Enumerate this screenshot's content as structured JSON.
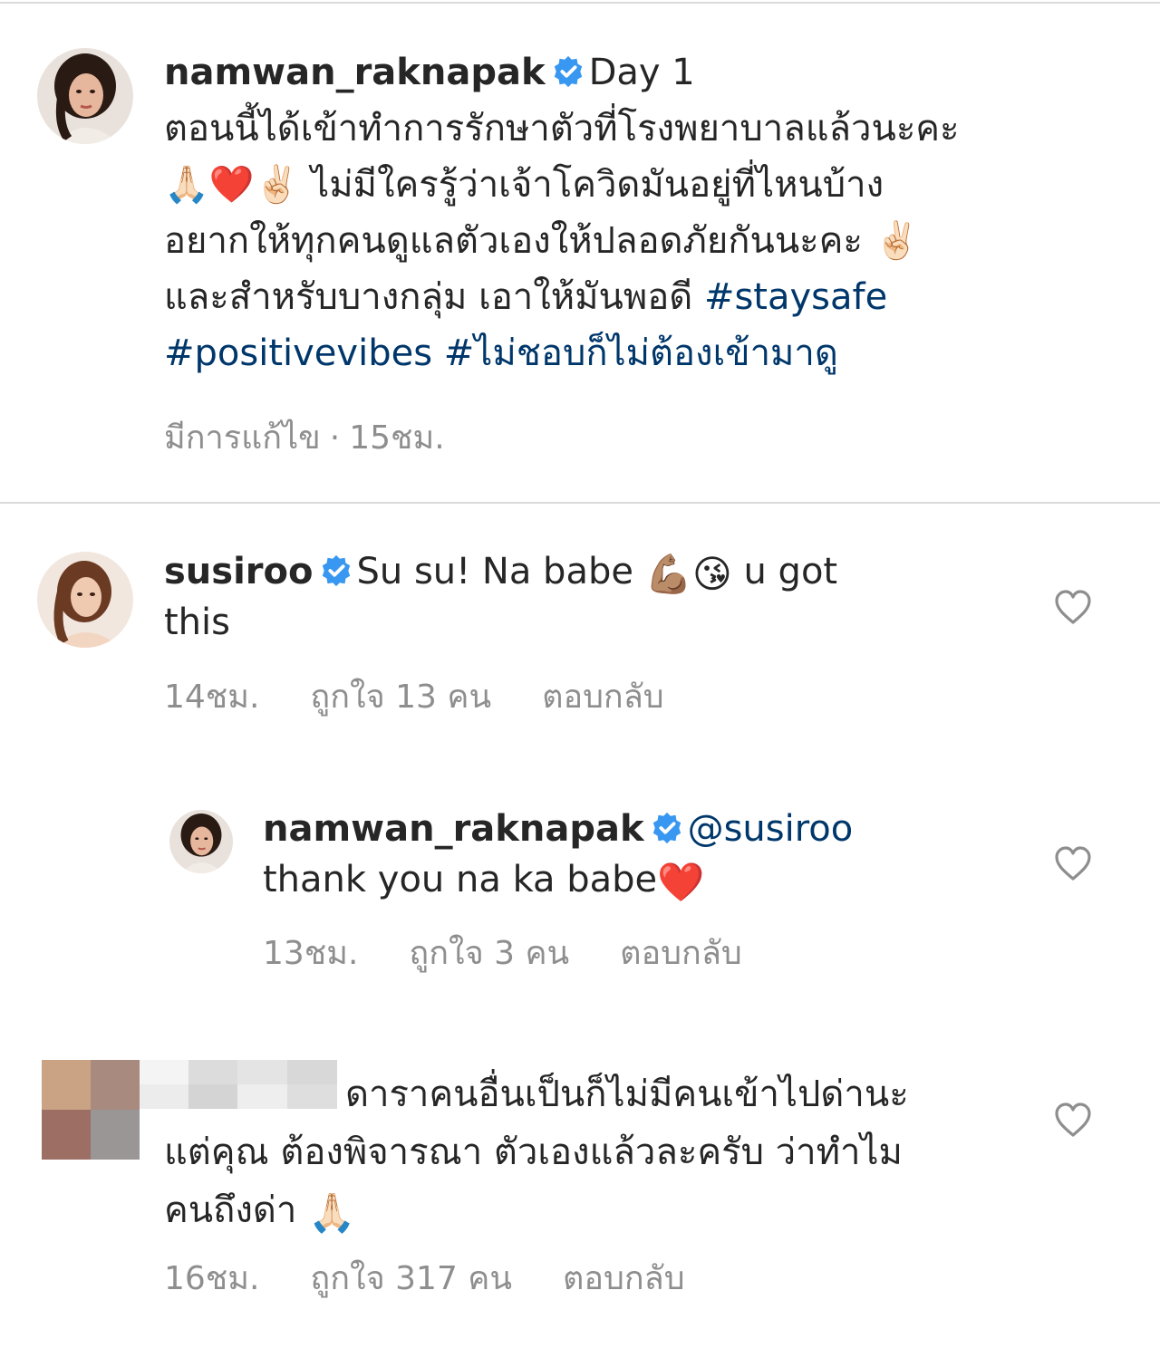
{
  "post": {
    "username": "namwan_raknapak",
    "caption_lines": [
      [
        "Day 1"
      ],
      [
        "ตอนนี้ได้เข้าทำการรักษาตัวที่โรงพยาบาลแล้วนะคะ"
      ],
      [
        "🙏🏻❤️✌🏻 ไม่มีใครรู้ว่าเจ้าโควิดมันอยู่ที่ไหนบ้าง"
      ],
      [
        "อยากให้ทุกคนดูแลตัวเองให้ปลอดภัยกันนะคะ ✌🏻"
      ]
    ],
    "line5_text": "และสำหรับบางกลุ่ม เอาให้มันพอดี ",
    "hashtag_1": "#staysafe",
    "hashtag_2": "#positivevibes",
    "hashtag_3": "#ไม่ชอบก็ไม่ต้องเข้ามาดู",
    "edited_label": "มีการแก้ไข",
    "time": "15ชม."
  },
  "comments": [
    {
      "username": "susiroo",
      "text_part1": "Su su! Na babe ",
      "emoji": "💪🏽😘",
      "text_part2": " u got",
      "text_line2": "this",
      "time": "14ชม.",
      "likes": "ถูกใจ 13 คน",
      "reply_label": "ตอบกลับ"
    },
    {
      "username": "namwan_raknapak",
      "mention": "@susiroo",
      "text": "thank you na ka babe",
      "emoji": "❤️",
      "time": "13ชม.",
      "likes": "ถูกใจ 3 คน",
      "reply_label": "ตอบกลับ"
    },
    {
      "text_line1": "ดาราคนอื่นเป็นก็ไม่มีคนเข้าไปด่านะ",
      "text_line2": "แต่คุณ ต้องพิจารณา ตัวเองแล้วละครับ ว่าทำไม",
      "text_line3": "คนถึงด่า ",
      "emoji": "🙏🏻",
      "time": "16ชม.",
      "likes": "ถูกใจ 317 คน",
      "reply_label": "ตอบกลับ"
    }
  ],
  "colors": {
    "text": "#262626",
    "secondary": "#8e8e8e",
    "link": "#00376b",
    "verified": "#3897f0",
    "divider": "#dbdbdb"
  },
  "icons": {
    "verified": "verified-badge-icon",
    "like": "heart-outline-icon"
  }
}
